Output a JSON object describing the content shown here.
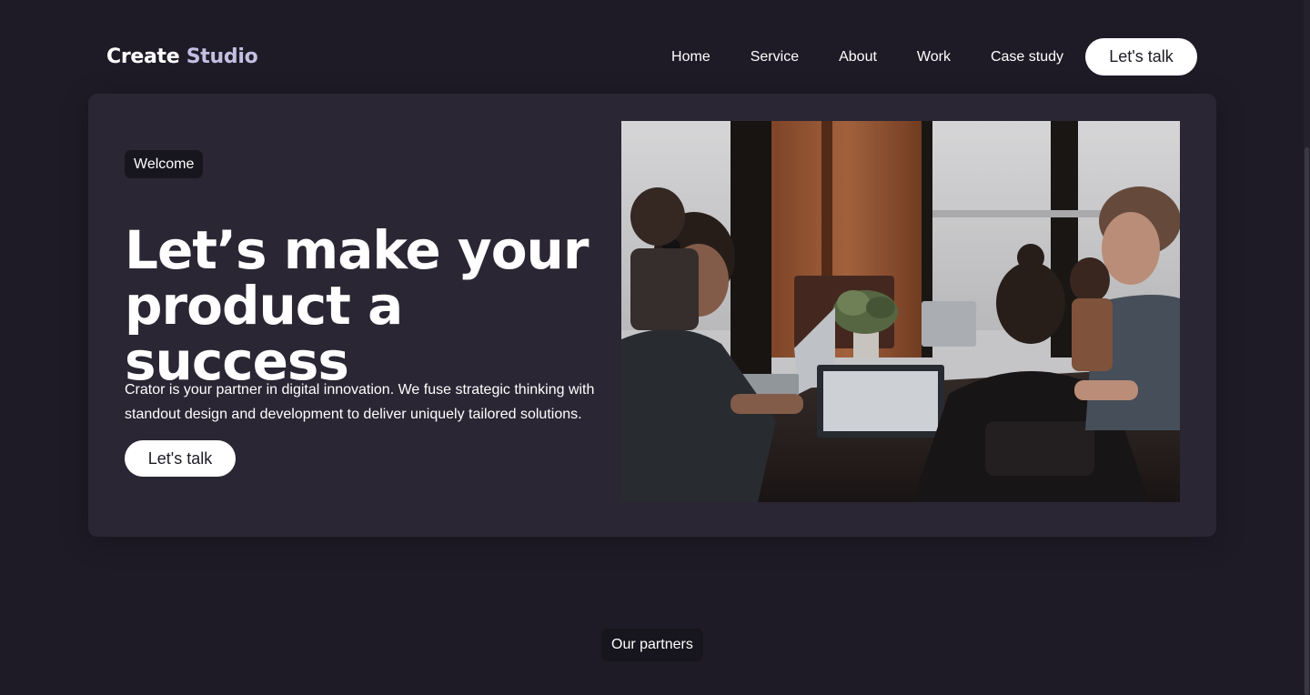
{
  "brand": {
    "name_primary": "Create",
    "name_accent": "Studio"
  },
  "nav": {
    "links": [
      {
        "label": "Home"
      },
      {
        "label": "Service"
      },
      {
        "label": "About"
      },
      {
        "label": "Work"
      },
      {
        "label": "Case study"
      }
    ],
    "cta_label": "Let's talk"
  },
  "hero": {
    "badge": "Welcome",
    "title_line1": "Let’s make your",
    "title_line2": "product a success",
    "description": "Crator is your partner in digital innovation. We fuse strategic thinking with standout design and development to deliver uniquely tailored solutions.",
    "cta_label": "Let's talk",
    "image_subject": "team-working-on-laptops-photo"
  },
  "partners": {
    "badge": "Our partners"
  },
  "colors": {
    "background": "#1e1b27",
    "card": "#2a2633",
    "badge_bg": "#17151d",
    "accent_text": "#c2bfe2",
    "button_bg": "#ffffff"
  }
}
